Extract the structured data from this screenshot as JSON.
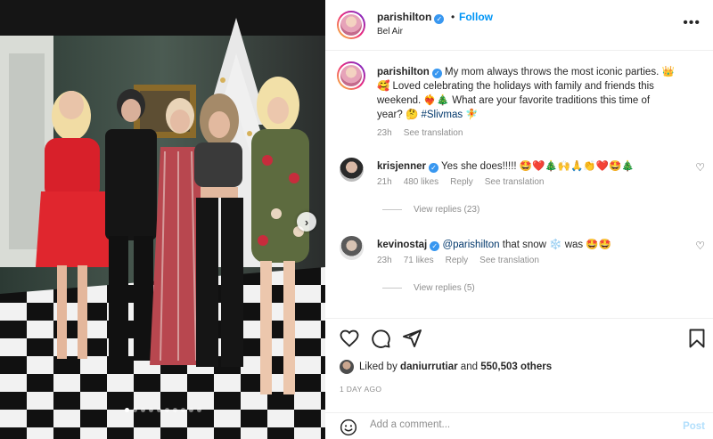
{
  "post": {
    "username": "parishilton",
    "follow_label": "Follow",
    "location": "Bel Air",
    "more_label": "•••"
  },
  "caption": {
    "username": "parishilton",
    "text_1": "My mom always throws the most iconic parties. 👑",
    "text_2": "🥰 Loved celebrating the holidays with family and friends this",
    "text_3": "weekend. ❤️‍🔥🎄 What are your favorite traditions this time of",
    "text_4": "year? 🤔",
    "hashtag": "#Slivmas",
    "text_5": "🧚",
    "time": "23h",
    "see_translation": "See translation"
  },
  "comments": [
    {
      "username": "krisjenner",
      "text": "Yes she does!!!!! 🤩❤️🎄🙌🙏👏❤️🤩🎄",
      "time": "21h",
      "likes": "480 likes",
      "reply": "Reply",
      "see_translation": "See translation",
      "view_replies": "View replies (23)"
    },
    {
      "username": "kevinostaj",
      "mention": "@parishilton",
      "text_before": "that snow",
      "text_after": "was 🤩🤩",
      "time": "23h",
      "likes": "71 likes",
      "reply": "Reply",
      "see_translation": "See translation",
      "view_replies": "View replies (5)"
    }
  ],
  "likes": {
    "prefix": "Liked by",
    "user": "daniurrutiar",
    "middle": "and",
    "count": "550,503 others"
  },
  "time_ago": "1 DAY AGO",
  "add_comment": {
    "placeholder": "Add a comment...",
    "post_label": "Post"
  },
  "carousel": {
    "dot_count": 10,
    "active_index": 0
  },
  "colors": {
    "accent_blue": "#0095f6",
    "verified_blue": "#3897f0",
    "muted_gray": "#8e8e8e"
  }
}
